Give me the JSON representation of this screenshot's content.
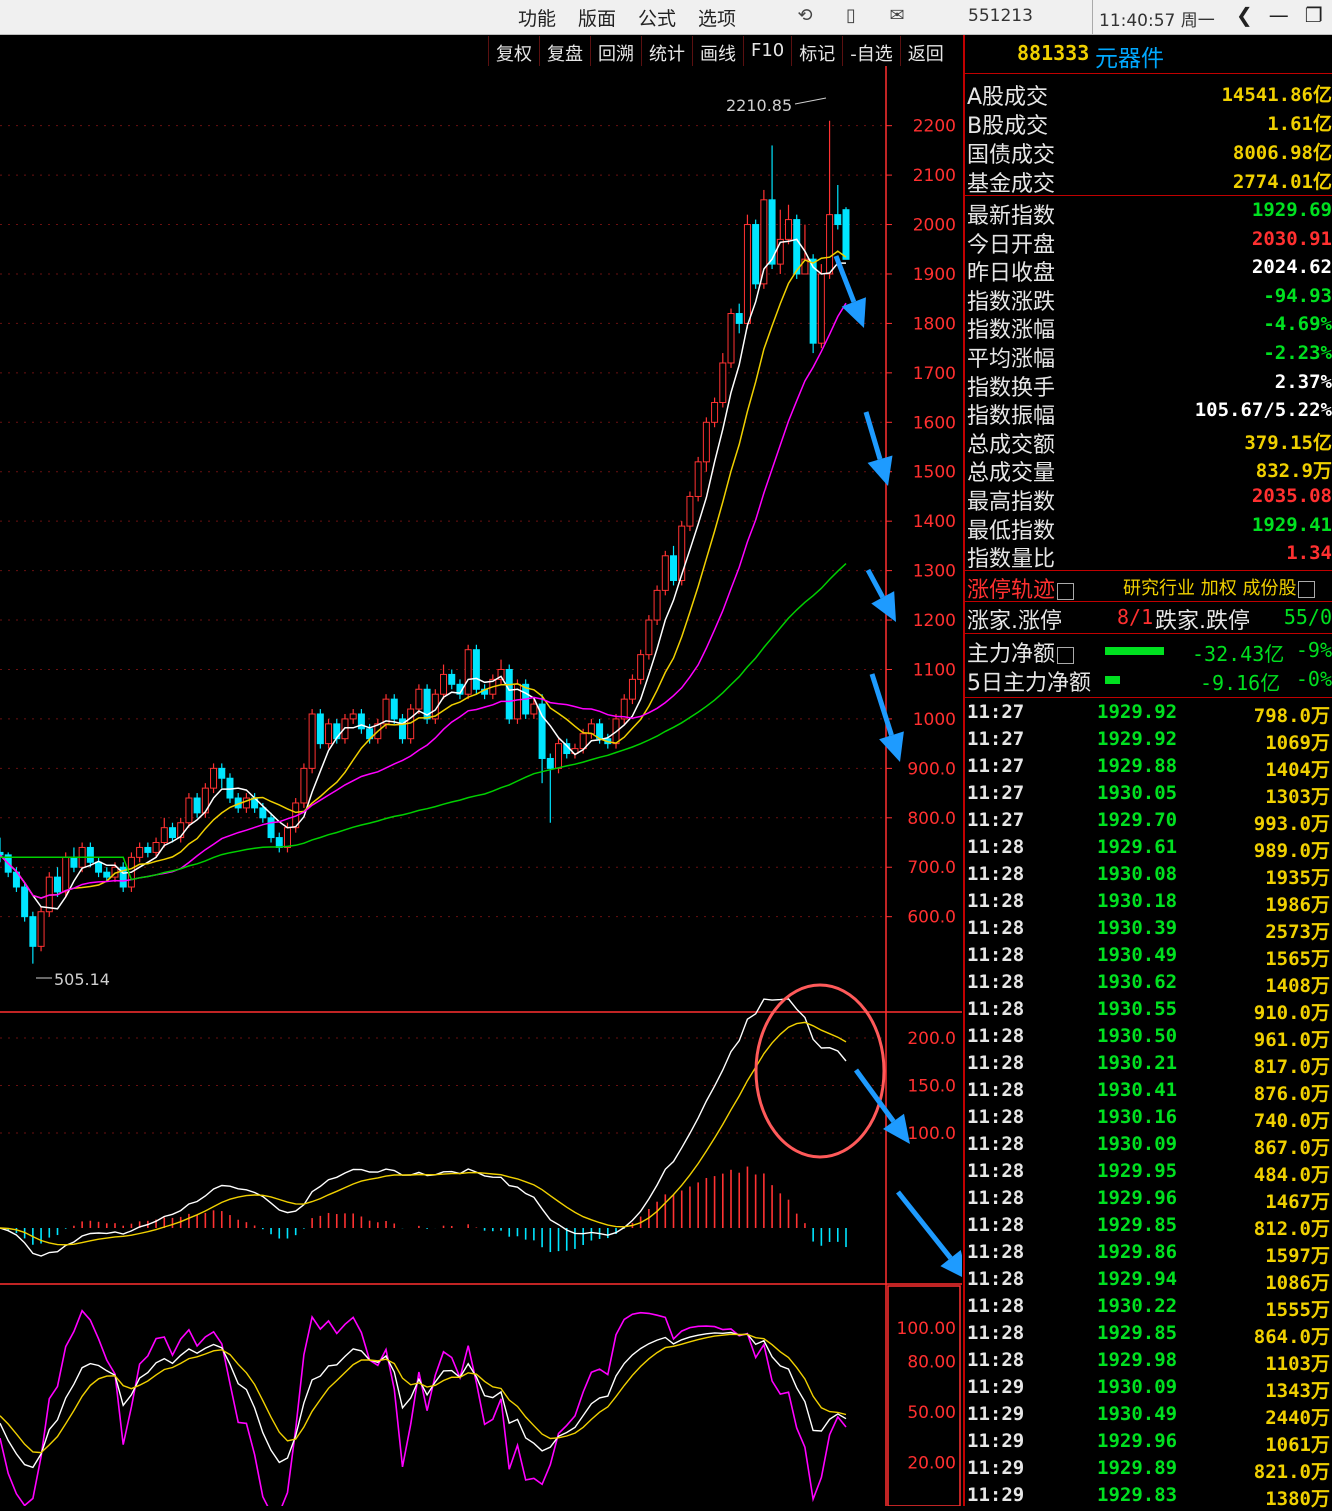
{
  "topbar": {
    "menu": [
      "功能",
      "版面",
      "公式",
      "选项"
    ],
    "icons": [
      "refresh-icon",
      "phone-icon",
      "message-icon"
    ],
    "code": "551213",
    "time": "11:40:57 周一",
    "window_controls": [
      "back-icon",
      "minimize-icon",
      "restore-icon"
    ]
  },
  "chart_toolbar": [
    "复权",
    "复盘",
    "回溯",
    "统计",
    "画线",
    "F10",
    "标记",
    "-自选",
    "返回"
  ],
  "colors": {
    "up": "#ff3232",
    "down": "#00e5ff",
    "ma5": "#ffffff",
    "ma10": "#f0d000",
    "ma20": "#ff00ff",
    "ma60": "#00d000",
    "grid": "#6a1010",
    "axis": "#ff3030",
    "arrow": "#1e9bff"
  },
  "chart_data": [
    {
      "type": "candlestick",
      "ylim": [
        480,
        2260
      ],
      "y_ticks": [
        "2200",
        "2100",
        "2000",
        "1900",
        "1800",
        "1700",
        "1600",
        "1500",
        "1400",
        "1300",
        "1200",
        "1100",
        "1000",
        "900.0",
        "800.0",
        "700.0",
        "600.0"
      ],
      "high_label": "2210.85",
      "low_label": "505.14",
      "candles": [
        [
          730,
          725,
          760,
          710
        ],
        [
          725,
          690,
          730,
          680
        ],
        [
          690,
          660,
          700,
          650
        ],
        [
          660,
          600,
          670,
          590
        ],
        [
          600,
          540,
          610,
          505
        ],
        [
          540,
          610,
          620,
          530
        ],
        [
          610,
          680,
          690,
          600
        ],
        [
          680,
          650,
          700,
          640
        ],
        [
          650,
          720,
          730,
          640
        ],
        [
          720,
          700,
          740,
          690
        ],
        [
          700,
          740,
          750,
          690
        ],
        [
          740,
          710,
          750,
          700
        ],
        [
          710,
          690,
          720,
          680
        ],
        [
          690,
          680,
          700,
          670
        ],
        [
          680,
          700,
          710,
          670
        ],
        [
          700,
          660,
          710,
          650
        ],
        [
          660,
          720,
          730,
          650
        ],
        [
          720,
          740,
          750,
          710
        ],
        [
          740,
          730,
          750,
          720
        ],
        [
          730,
          750,
          760,
          720
        ],
        [
          750,
          780,
          800,
          740
        ],
        [
          780,
          760,
          790,
          750
        ],
        [
          760,
          790,
          800,
          750
        ],
        [
          790,
          840,
          850,
          780
        ],
        [
          840,
          810,
          850,
          800
        ],
        [
          810,
          860,
          870,
          800
        ],
        [
          860,
          900,
          910,
          850
        ],
        [
          900,
          880,
          910,
          860
        ],
        [
          880,
          840,
          890,
          830
        ],
        [
          840,
          820,
          850,
          810
        ],
        [
          820,
          840,
          850,
          810
        ],
        [
          840,
          820,
          850,
          810
        ],
        [
          820,
          800,
          830,
          790
        ],
        [
          800,
          760,
          810,
          750
        ],
        [
          760,
          740,
          770,
          730
        ],
        [
          740,
          780,
          790,
          730
        ],
        [
          780,
          830,
          840,
          770
        ],
        [
          830,
          900,
          910,
          820
        ],
        [
          900,
          1010,
          1020,
          890
        ],
        [
          1010,
          950,
          1020,
          940
        ],
        [
          950,
          990,
          1000,
          940
        ],
        [
          990,
          960,
          1000,
          950
        ],
        [
          960,
          1000,
          1010,
          950
        ],
        [
          1000,
          1010,
          1020,
          990
        ],
        [
          1010,
          980,
          1020,
          970
        ],
        [
          980,
          960,
          990,
          950
        ],
        [
          960,
          990,
          1000,
          950
        ],
        [
          990,
          1040,
          1050,
          980
        ],
        [
          1040,
          1000,
          1050,
          990
        ],
        [
          1000,
          960,
          1010,
          950
        ],
        [
          960,
          1020,
          1030,
          950
        ],
        [
          1020,
          1060,
          1070,
          1010
        ],
        [
          1060,
          1000,
          1070,
          990
        ],
        [
          1000,
          1050,
          1060,
          990
        ],
        [
          1050,
          1090,
          1110,
          1040
        ],
        [
          1090,
          1070,
          1100,
          1060
        ],
        [
          1070,
          1050,
          1080,
          1040
        ],
        [
          1050,
          1140,
          1150,
          1040
        ],
        [
          1140,
          1060,
          1150,
          1050
        ],
        [
          1060,
          1050,
          1070,
          1040
        ],
        [
          1050,
          1080,
          1090,
          1040
        ],
        [
          1080,
          1100,
          1120,
          1070
        ],
        [
          1100,
          1000,
          1110,
          990
        ],
        [
          1000,
          1070,
          1080,
          990
        ],
        [
          1070,
          1010,
          1080,
          1000
        ],
        [
          1010,
          1030,
          1040,
          1000
        ],
        [
          1030,
          920,
          1050,
          870
        ],
        [
          920,
          900,
          930,
          790
        ],
        [
          900,
          950,
          960,
          890
        ],
        [
          950,
          930,
          960,
          920
        ],
        [
          930,
          940,
          950,
          920
        ],
        [
          940,
          970,
          980,
          930
        ],
        [
          970,
          990,
          1000,
          960
        ],
        [
          990,
          960,
          1000,
          950
        ],
        [
          960,
          950,
          970,
          940
        ],
        [
          950,
          1000,
          1010,
          940
        ],
        [
          1000,
          1040,
          1050,
          990
        ],
        [
          1040,
          1080,
          1090,
          1030
        ],
        [
          1080,
          1130,
          1140,
          1070
        ],
        [
          1130,
          1200,
          1210,
          1120
        ],
        [
          1200,
          1260,
          1270,
          1190
        ],
        [
          1260,
          1330,
          1340,
          1250
        ],
        [
          1330,
          1280,
          1350,
          1270
        ],
        [
          1280,
          1390,
          1400,
          1270
        ],
        [
          1390,
          1450,
          1460,
          1380
        ],
        [
          1450,
          1520,
          1530,
          1440
        ],
        [
          1520,
          1600,
          1610,
          1500
        ],
        [
          1600,
          1640,
          1650,
          1590
        ],
        [
          1640,
          1720,
          1740,
          1630
        ],
        [
          1720,
          1820,
          1830,
          1710
        ],
        [
          1820,
          1800,
          1840,
          1780
        ],
        [
          1800,
          2000,
          2020,
          1790
        ],
        [
          2000,
          1880,
          2010,
          1870
        ],
        [
          1880,
          2050,
          2070,
          1870
        ],
        [
          2050,
          1920,
          2160,
          1910
        ],
        [
          1920,
          1970,
          2030,
          1900
        ],
        [
          1970,
          2010,
          2040,
          1960
        ],
        [
          2010,
          1900,
          2020,
          1890
        ],
        [
          1900,
          1930,
          2000,
          1900
        ],
        [
          1930,
          1760,
          1940,
          1740
        ],
        [
          1760,
          1900,
          1920,
          1750
        ],
        [
          1900,
          2020,
          2210,
          1890
        ],
        [
          2020,
          2000,
          2080,
          1990
        ],
        [
          2030,
          1929.69,
          2035,
          1929.41
        ]
      ],
      "ma_series": [
        "MA5",
        "MA10",
        "MA20",
        "MA60"
      ]
    },
    {
      "type": "macd",
      "y_ticks": [
        "200.0",
        "150.0",
        "100.0"
      ]
    },
    {
      "type": "kdj",
      "y_ticks": [
        "100.00",
        "80.00",
        "50.00",
        "20.00"
      ]
    }
  ],
  "panel": {
    "code": "881333",
    "name": "元器件",
    "market": [
      {
        "label": "A股成交",
        "value": "14541.86亿",
        "color": "#f0d000"
      },
      {
        "label": "B股成交",
        "value": "1.61亿",
        "color": "#f0d000"
      },
      {
        "label": "国债成交",
        "value": "8006.98亿",
        "color": "#f0d000"
      },
      {
        "label": "基金成交",
        "value": "2774.01亿",
        "color": "#f0d000"
      }
    ],
    "stats": [
      {
        "label": "最新指数",
        "value": "1929.69",
        "color": "#00e020"
      },
      {
        "label": "今日开盘",
        "value": "2030.91",
        "color": "#ff3030"
      },
      {
        "label": "昨日收盘",
        "value": "2024.62",
        "color": "#ffffff"
      },
      {
        "label": "指数涨跌",
        "value": "-94.93",
        "color": "#00e020"
      },
      {
        "label": "指数涨幅",
        "value": "-4.69%",
        "color": "#00e020"
      },
      {
        "label": "平均涨幅",
        "value": "-2.23%",
        "color": "#00e020"
      },
      {
        "label": "指数换手",
        "value": "2.37%",
        "color": "#ffffff"
      },
      {
        "label": "指数振幅",
        "value": "105.67/5.22%",
        "color": "#ffffff"
      },
      {
        "label": "总成交额",
        "value": "379.15亿",
        "color": "#f0d000"
      },
      {
        "label": "总成交量",
        "value": "832.9万",
        "color": "#f0d000"
      },
      {
        "label": "最高指数",
        "value": "2035.08",
        "color": "#ff3030"
      },
      {
        "label": "最低指数",
        "value": "1929.41",
        "color": "#00e020"
      },
      {
        "label": "指数量比",
        "value": "1.34",
        "color": "#ff3030"
      }
    ],
    "zt_title": "涨停轨迹",
    "zt_links": "研究行业 加权 成份股",
    "zhang_label": "涨家.涨停",
    "zhang_value": "8/1",
    "die_label": "跌家.跌停",
    "die_value": "55/0",
    "main_flow": {
      "label": "主力净额",
      "value": "-32.43亿",
      "pct": "-9%",
      "bar": 0.9
    },
    "main_flow5": {
      "label": "5日主力净额",
      "value": "-9.16亿",
      "pct": "-0%",
      "bar": 0.22
    },
    "ticks": [
      [
        "11:27",
        "1929.92",
        "798.0万"
      ],
      [
        "11:27",
        "1929.92",
        "1069万"
      ],
      [
        "11:27",
        "1929.88",
        "1404万"
      ],
      [
        "11:27",
        "1930.05",
        "1303万"
      ],
      [
        "11:27",
        "1929.70",
        "993.0万"
      ],
      [
        "11:28",
        "1929.61",
        "989.0万"
      ],
      [
        "11:28",
        "1930.08",
        "1935万"
      ],
      [
        "11:28",
        "1930.18",
        "1986万"
      ],
      [
        "11:28",
        "1930.39",
        "2573万"
      ],
      [
        "11:28",
        "1930.49",
        "1565万"
      ],
      [
        "11:28",
        "1930.62",
        "1408万"
      ],
      [
        "11:28",
        "1930.55",
        "910.0万"
      ],
      [
        "11:28",
        "1930.50",
        "961.0万"
      ],
      [
        "11:28",
        "1930.21",
        "817.0万"
      ],
      [
        "11:28",
        "1930.41",
        "876.0万"
      ],
      [
        "11:28",
        "1930.16",
        "740.0万"
      ],
      [
        "11:28",
        "1930.09",
        "867.0万"
      ],
      [
        "11:28",
        "1929.95",
        "484.0万"
      ],
      [
        "11:28",
        "1929.96",
        "1467万"
      ],
      [
        "11:28",
        "1929.85",
        "812.0万"
      ],
      [
        "11:28",
        "1929.86",
        "1597万"
      ],
      [
        "11:28",
        "1929.94",
        "1086万"
      ],
      [
        "11:28",
        "1930.22",
        "1555万"
      ],
      [
        "11:28",
        "1929.85",
        "864.0万"
      ],
      [
        "11:28",
        "1929.98",
        "1103万"
      ],
      [
        "11:29",
        "1930.09",
        "1343万"
      ],
      [
        "11:29",
        "1930.49",
        "2440万"
      ],
      [
        "11:29",
        "1929.96",
        "1061万"
      ],
      [
        "11:29",
        "1929.89",
        "821.0万"
      ],
      [
        "11:29",
        "1929.83",
        "1380万"
      ]
    ]
  }
}
